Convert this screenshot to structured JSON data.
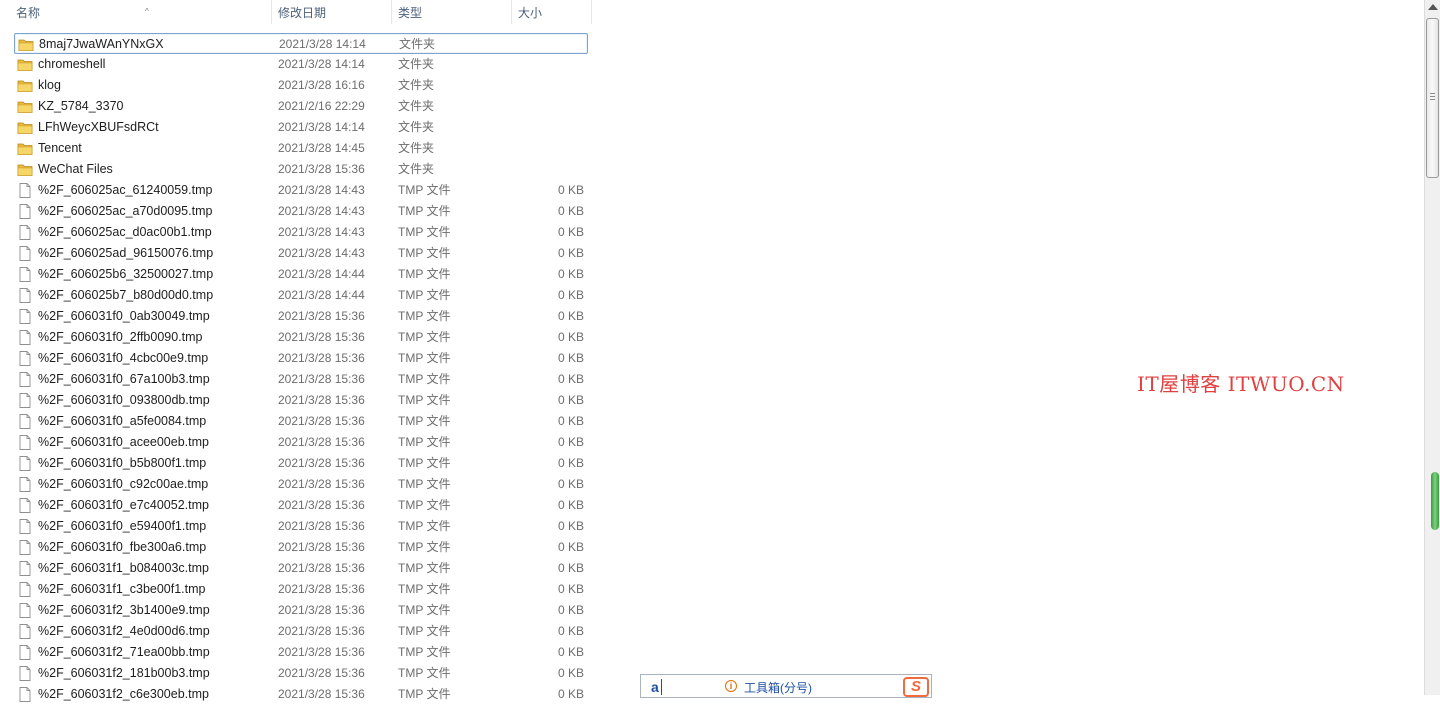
{
  "header": {
    "columns": [
      "名称",
      "修改日期",
      "类型",
      "大小"
    ],
    "sort_indicator": "^"
  },
  "files": [
    {
      "name": "8maj7JwaWAnYNxGX",
      "date": "2021/3/28 14:14",
      "type": "文件夹",
      "size": "",
      "kind": "folder",
      "selected": true
    },
    {
      "name": "chromeshell",
      "date": "2021/3/28 14:14",
      "type": "文件夹",
      "size": "",
      "kind": "folder"
    },
    {
      "name": "klog",
      "date": "2021/3/28 16:16",
      "type": "文件夹",
      "size": "",
      "kind": "folder"
    },
    {
      "name": "KZ_5784_3370",
      "date": "2021/2/16 22:29",
      "type": "文件夹",
      "size": "",
      "kind": "folder"
    },
    {
      "name": "LFhWeycXBUFsdRCt",
      "date": "2021/3/28 14:14",
      "type": "文件夹",
      "size": "",
      "kind": "folder"
    },
    {
      "name": "Tencent",
      "date": "2021/3/28 14:45",
      "type": "文件夹",
      "size": "",
      "kind": "folder"
    },
    {
      "name": "WeChat Files",
      "date": "2021/3/28 15:36",
      "type": "文件夹",
      "size": "",
      "kind": "folder"
    },
    {
      "name": "%2F_606025ac_61240059.tmp",
      "date": "2021/3/28 14:43",
      "type": "TMP 文件",
      "size": "0 KB",
      "kind": "file"
    },
    {
      "name": "%2F_606025ac_a70d0095.tmp",
      "date": "2021/3/28 14:43",
      "type": "TMP 文件",
      "size": "0 KB",
      "kind": "file"
    },
    {
      "name": "%2F_606025ac_d0ac00b1.tmp",
      "date": "2021/3/28 14:43",
      "type": "TMP 文件",
      "size": "0 KB",
      "kind": "file"
    },
    {
      "name": "%2F_606025ad_96150076.tmp",
      "date": "2021/3/28 14:43",
      "type": "TMP 文件",
      "size": "0 KB",
      "kind": "file"
    },
    {
      "name": "%2F_606025b6_32500027.tmp",
      "date": "2021/3/28 14:44",
      "type": "TMP 文件",
      "size": "0 KB",
      "kind": "file"
    },
    {
      "name": "%2F_606025b7_b80d00d0.tmp",
      "date": "2021/3/28 14:44",
      "type": "TMP 文件",
      "size": "0 KB",
      "kind": "file"
    },
    {
      "name": "%2F_606031f0_0ab30049.tmp",
      "date": "2021/3/28 15:36",
      "type": "TMP 文件",
      "size": "0 KB",
      "kind": "file"
    },
    {
      "name": "%2F_606031f0_2ffb0090.tmp",
      "date": "2021/3/28 15:36",
      "type": "TMP 文件",
      "size": "0 KB",
      "kind": "file"
    },
    {
      "name": "%2F_606031f0_4cbc00e9.tmp",
      "date": "2021/3/28 15:36",
      "type": "TMP 文件",
      "size": "0 KB",
      "kind": "file"
    },
    {
      "name": "%2F_606031f0_67a100b3.tmp",
      "date": "2021/3/28 15:36",
      "type": "TMP 文件",
      "size": "0 KB",
      "kind": "file"
    },
    {
      "name": "%2F_606031f0_093800db.tmp",
      "date": "2021/3/28 15:36",
      "type": "TMP 文件",
      "size": "0 KB",
      "kind": "file"
    },
    {
      "name": "%2F_606031f0_a5fe0084.tmp",
      "date": "2021/3/28 15:36",
      "type": "TMP 文件",
      "size": "0 KB",
      "kind": "file"
    },
    {
      "name": "%2F_606031f0_acee00eb.tmp",
      "date": "2021/3/28 15:36",
      "type": "TMP 文件",
      "size": "0 KB",
      "kind": "file"
    },
    {
      "name": "%2F_606031f0_b5b800f1.tmp",
      "date": "2021/3/28 15:36",
      "type": "TMP 文件",
      "size": "0 KB",
      "kind": "file"
    },
    {
      "name": "%2F_606031f0_c92c00ae.tmp",
      "date": "2021/3/28 15:36",
      "type": "TMP 文件",
      "size": "0 KB",
      "kind": "file"
    },
    {
      "name": "%2F_606031f0_e7c40052.tmp",
      "date": "2021/3/28 15:36",
      "type": "TMP 文件",
      "size": "0 KB",
      "kind": "file"
    },
    {
      "name": "%2F_606031f0_e59400f1.tmp",
      "date": "2021/3/28 15:36",
      "type": "TMP 文件",
      "size": "0 KB",
      "kind": "file"
    },
    {
      "name": "%2F_606031f0_fbe300a6.tmp",
      "date": "2021/3/28 15:36",
      "type": "TMP 文件",
      "size": "0 KB",
      "kind": "file"
    },
    {
      "name": "%2F_606031f1_b084003c.tmp",
      "date": "2021/3/28 15:36",
      "type": "TMP 文件",
      "size": "0 KB",
      "kind": "file"
    },
    {
      "name": "%2F_606031f1_c3be00f1.tmp",
      "date": "2021/3/28 15:36",
      "type": "TMP 文件",
      "size": "0 KB",
      "kind": "file"
    },
    {
      "name": "%2F_606031f2_3b1400e9.tmp",
      "date": "2021/3/28 15:36",
      "type": "TMP 文件",
      "size": "0 KB",
      "kind": "file"
    },
    {
      "name": "%2F_606031f2_4e0d00d6.tmp",
      "date": "2021/3/28 15:36",
      "type": "TMP 文件",
      "size": "0 KB",
      "kind": "file"
    },
    {
      "name": "%2F_606031f2_71ea00bb.tmp",
      "date": "2021/3/28 15:36",
      "type": "TMP 文件",
      "size": "0 KB",
      "kind": "file"
    },
    {
      "name": "%2F_606031f2_181b00b3.tmp",
      "date": "2021/3/28 15:36",
      "type": "TMP 文件",
      "size": "0 KB",
      "kind": "file"
    },
    {
      "name": "%2F_606031f2_c6e300eb.tmp",
      "date": "2021/3/28 15:36",
      "type": "TMP 文件",
      "size": "0 KB",
      "kind": "file"
    }
  ],
  "watermark": "IT屋博客 ITWUO.CN",
  "ime": {
    "input_text": "a",
    "toolbox_label": "工具箱(分号)",
    "logo_text": "S"
  },
  "colors": {
    "folder": "#e8b93a",
    "selection_border": "#7da2ce",
    "watermark": "#e04040"
  }
}
